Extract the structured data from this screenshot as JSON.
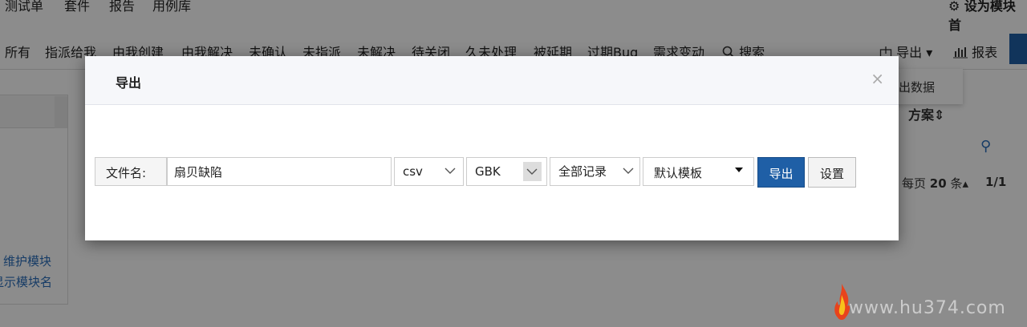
{
  "topnav": {
    "items": [
      "测试单",
      "套件",
      "报告",
      "用例库"
    ],
    "module_setting": "设为模块首"
  },
  "tabs": [
    "所有",
    "指派给我",
    "由我创建",
    "由我解决",
    "未确认",
    "未指派",
    "未解决",
    "待关闭",
    "久未处理",
    "被延期",
    "过期Bug",
    "需求变动"
  ],
  "search_label": "搜索",
  "toolbar": {
    "export_label": "导出",
    "report_label": "报表",
    "export_menu_item": "出数据"
  },
  "right_panel": {
    "plan_label": "方案",
    "per_page_prefix": "每页",
    "per_page_value": "20",
    "per_page_suffix": "条",
    "pagination": "1/1"
  },
  "left_panel": {
    "link1": "维护模块",
    "link2": "显示模块名"
  },
  "modal": {
    "title": "导出",
    "close": "×",
    "filename_label": "文件名:",
    "filename_value": "扇贝缺陷",
    "format": "csv",
    "encoding": "GBK",
    "range": "全部记录",
    "template": "默认模板",
    "export_button": "导出",
    "settings_button": "设置"
  },
  "watermark": "www.hu374.com",
  "colors": {
    "primary": "#1f5fa6",
    "link": "#2a6ebb"
  }
}
